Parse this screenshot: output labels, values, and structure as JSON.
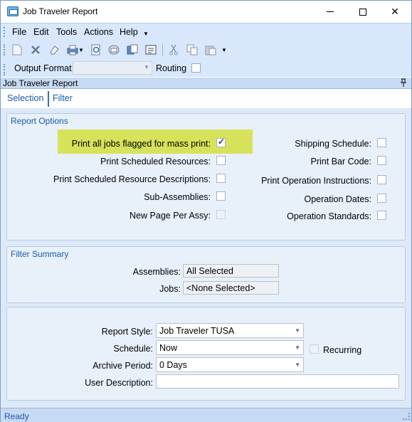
{
  "window": {
    "title": "Job Traveler Report"
  },
  "menu": {
    "items": [
      "File",
      "Edit",
      "Tools",
      "Actions",
      "Help"
    ]
  },
  "toolbar": {
    "icons": [
      "new-icon",
      "delete-icon",
      "clear-icon",
      "print-icon",
      "print-preview-icon",
      "email-icon",
      "attach-icon",
      "generate-icon",
      "cut-icon",
      "copy-icon",
      "paste-icon"
    ]
  },
  "format_bar": {
    "output_format_label": "Output Format:",
    "output_format_value": "",
    "routing_label": "Routing",
    "routing_checked": false
  },
  "panel": {
    "title": "Job Traveler Report"
  },
  "tabs": [
    {
      "label": "Selection",
      "selected": true
    },
    {
      "label": "Filter",
      "selected": false
    }
  ],
  "report_options": {
    "title": "Report Options",
    "left": [
      {
        "label": "Print all jobs flagged for mass print:",
        "checked": true,
        "disabled": false,
        "highlighted": true
      },
      {
        "label": "Print Scheduled Resources:",
        "checked": false,
        "disabled": false
      },
      {
        "label": "Print Scheduled Resource Descriptions:",
        "checked": false,
        "disabled": false
      },
      {
        "label": "Sub-Assemblies:",
        "checked": false,
        "disabled": false
      },
      {
        "label": "New Page Per Assy:",
        "checked": false,
        "disabled": true
      }
    ],
    "right": [
      {
        "label": "Shipping Schedule:",
        "checked": false
      },
      {
        "label": "Print Bar Code:",
        "checked": false
      },
      {
        "label": "Print Operation Instructions:",
        "checked": false
      },
      {
        "label": "Operation Dates:",
        "checked": false
      },
      {
        "label": "Operation Standards:",
        "checked": false
      }
    ]
  },
  "filter_summary": {
    "title": "Filter Summary",
    "assemblies_label": "Assemblies:",
    "assemblies_value": "All Selected",
    "jobs_label": "Jobs:",
    "jobs_value": "<None Selected>"
  },
  "report_settings": {
    "report_style_label": "Report Style:",
    "report_style_value": "Job Traveler TUSA",
    "schedule_label": "Schedule:",
    "schedule_value": "Now",
    "recurring_label": "Recurring",
    "recurring_checked": false,
    "archive_label": "Archive Period:",
    "archive_value": "0 Days",
    "user_desc_label": "User Description:",
    "user_desc_value": ""
  },
  "status": {
    "text": "Ready"
  },
  "colors": {
    "accent_blue": "#1a5aa8",
    "highlight": "#d6e35a",
    "toolbar_bg": "#d8e7fb"
  }
}
